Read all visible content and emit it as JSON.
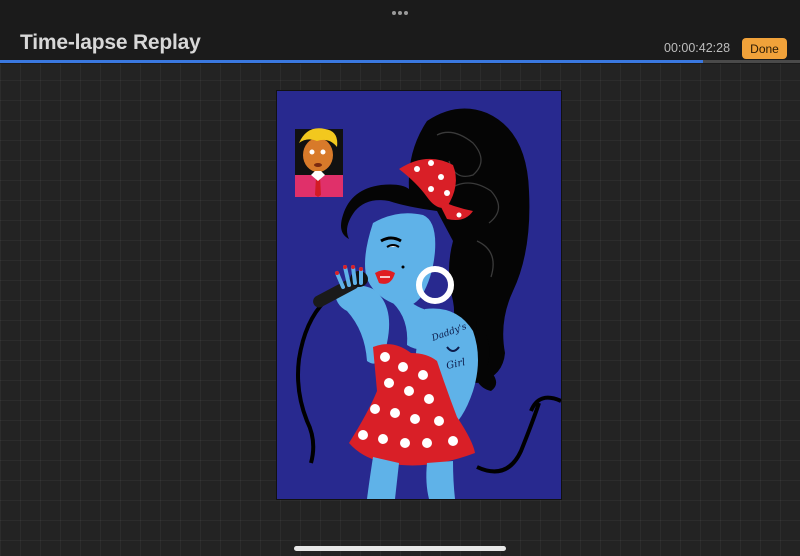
{
  "header": {
    "title": "Time-lapse Replay",
    "timecode": "00:00:42:28",
    "done_label": "Done"
  },
  "playback": {
    "progress_fraction": 0.879
  },
  "artwork": {
    "tattoo_text_line1": "Daddy's",
    "tattoo_text_line2": "Girl"
  },
  "colors": {
    "accent_button": "#f1a23a",
    "progress": "#3a78e0",
    "canvas_background": "#28298f"
  },
  "icons": {
    "more": "more-dots-icon"
  }
}
